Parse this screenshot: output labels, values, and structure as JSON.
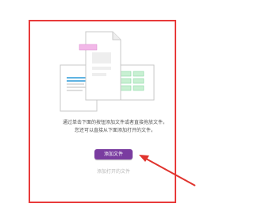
{
  "dropzone": {
    "hint_line1": "通过单击下面的按钮添加文件或者直接拖放文件。",
    "hint_line2": "您还可以直接从下面添加打开的文件。"
  },
  "actions": {
    "add_file_label": "添加文件",
    "add_open_file_label": "添加打开的文件"
  },
  "colors": {
    "border": "#e83a3a",
    "button": "#7a3ca0",
    "arrow": "#e0342e",
    "highlight_pink": "#f2b8e8",
    "cell_green": "#c8f0d2",
    "line_blue": "#2a9ad8"
  },
  "icons": {
    "illustration": "document-stack-illustration",
    "annotation": "red-arrow-icon"
  }
}
